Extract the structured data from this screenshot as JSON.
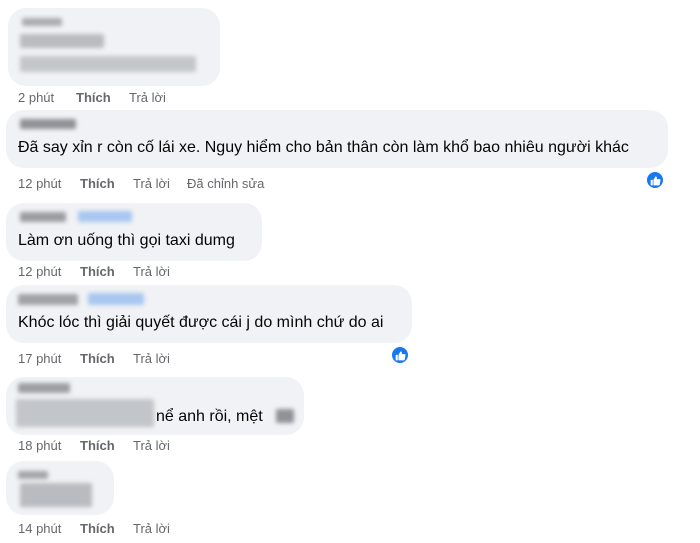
{
  "comments": [
    {
      "text": "",
      "time": "2 phút",
      "like": "Thích",
      "reply": "Trả lời"
    },
    {
      "text": "Đã say xỉn r còn cố lái xe. Nguy hiểm cho bản thân còn làm khổ bao nhiêu người khác",
      "time": "12 phút",
      "like": "Thích",
      "reply": "Trả lời",
      "edited": "Đã chỉnh sửa",
      "reaction_icon": "like-icon"
    },
    {
      "text": "Làm ơn uống thì gọi taxi dumg",
      "time": "12 phút",
      "like": "Thích",
      "reply": "Trả lời"
    },
    {
      "text": "Khóc lóc thì giải quyết được cái j do mình chứ do ai",
      "time": "17 phút",
      "like": "Thích",
      "reply": "Trả lời",
      "reaction_icon": "like-icon"
    },
    {
      "text": "nể anh rồi, mệt",
      "time": "18 phút",
      "like": "Thích",
      "reply": "Trả lời"
    },
    {
      "text": "",
      "time": "14 phút",
      "like": "Thích",
      "reply": "Trả lời"
    }
  ],
  "colors": {
    "bubble": "#f0f2f5",
    "meta_text": "#65676b",
    "like_reaction": "#1877f2"
  }
}
